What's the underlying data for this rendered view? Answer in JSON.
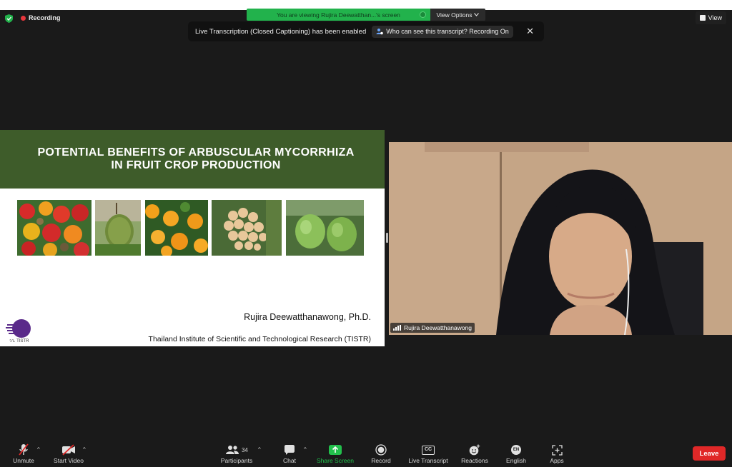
{
  "meeting": {
    "recording_label": "Recording",
    "viewing_banner": "You are viewing Rujira Deewatthan...'s screen",
    "view_options_label": "View Options",
    "view_label": "View"
  },
  "toast": {
    "message": "Live Transcription (Closed Captioning) has been enabled",
    "link_label": "Who can see this transcript? Recording On"
  },
  "slide": {
    "title_line1": "POTENTIAL BENEFITS OF ARBUSCULAR MYCORRHIZA",
    "title_line2": "IN FRUIT CROP PRODUCTION",
    "author": "Rujira Deewatthanawong, Ph.D.",
    "institute": "Thailand Institute of Scientific and Technological Research (TISTR)",
    "logo_text": "วว. TISTR",
    "photos": [
      "cashew-photo",
      "durian-photo",
      "orange-photo",
      "longkong-photo",
      "pomelo-photo"
    ],
    "header_color": "#3e5c2a"
  },
  "video": {
    "participant_name": "Rujira Deewatthanawong"
  },
  "toolbar": {
    "unmute": "Unmute",
    "start_video": "Start Video",
    "participants": "Participants",
    "participants_count": "34",
    "chat": "Chat",
    "share_screen": "Share Screen",
    "record": "Record",
    "live_transcript": "Live Transcript",
    "reactions": "Reactions",
    "english": "English",
    "apps": "Apps",
    "leave": "Leave",
    "cc_badge": "CC",
    "en_badge": "EN"
  },
  "colors": {
    "share_green": "#22c04c",
    "leave_red": "#e02828",
    "banner_green": "#22b24c",
    "recording_red": "#e8373c"
  }
}
